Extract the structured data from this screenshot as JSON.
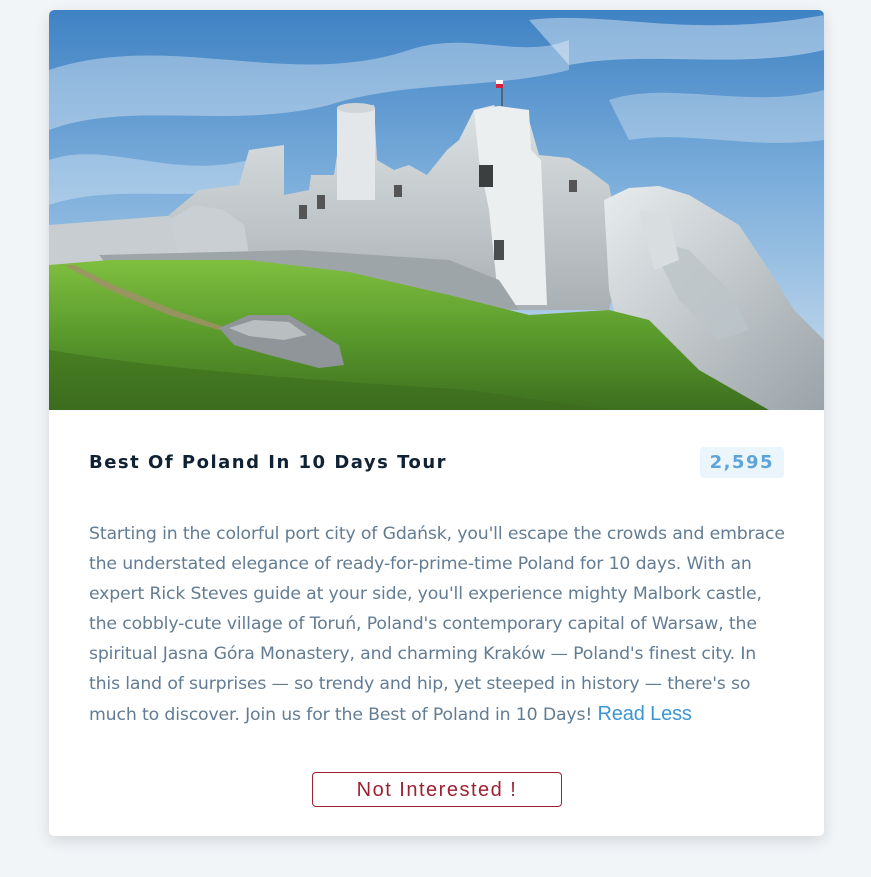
{
  "tour": {
    "title": "Best Of Poland In 10 Days Tour",
    "price": "2,595",
    "description": "Starting in the colorful port city of Gdańsk, you'll escape the crowds and embrace the understated elegance of ready-for-prime-time Poland for 10 days. With an expert Rick Steves guide at your side, you'll experience mighty Malbork castle, the cobbly-cute village of Toruń, Poland's contemporary capital of Warsaw, the spiritual Jasna Góra Monastery, and charming Kraków — Poland's finest city. In this land of surprises — so trendy and hip, yet steeped in history — there's so much to discover. Join us for the Best of Poland in 10 Days! ",
    "read_less_label": "Read Less",
    "not_interested_label": "Not Interested !"
  },
  "colors": {
    "page_background": "#f1f5f8",
    "title": "#0f2233",
    "price_text": "#5fa4d8",
    "price_background": "#ebf5fc",
    "description": "#627c93",
    "link": "#3c96d4",
    "danger": "#9b2230"
  },
  "image": {
    "subject": "castle ruins on a grassy hill under a blue sky"
  }
}
